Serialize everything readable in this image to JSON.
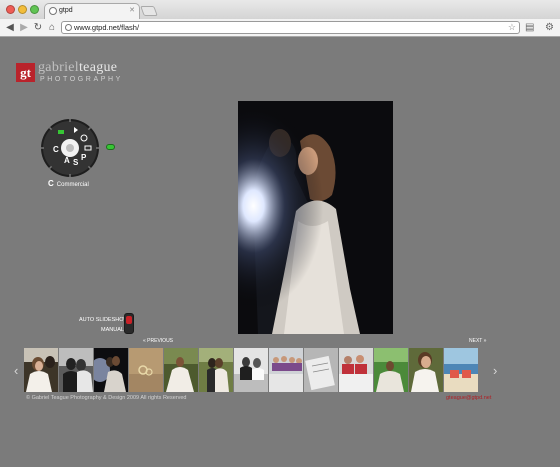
{
  "browser": {
    "tab_title": "gtpd",
    "url": "www.gtpd.net/flash/"
  },
  "logo": {
    "mark": "gt",
    "first_name": "gabriel",
    "last_name": "teague",
    "subtitle": "PHOTOGRAPHY"
  },
  "dial": {
    "letters": [
      "A",
      "S",
      "P",
      "C"
    ],
    "mode_letter": "C",
    "mode_name": "Commercial",
    "led_color": "#37c535"
  },
  "slideshow": {
    "auto_label": "AUTO SLIDESHOW",
    "manual_label": "MANUAL",
    "switch_color": "#c92228"
  },
  "thumbnails": {
    "previous_label": "« PREVIOUS",
    "next_label": "NEXT »",
    "left_arrow": "‹",
    "right_arrow": "›",
    "items": [
      {
        "name": "bride-laughing"
      },
      {
        "name": "couple-bw"
      },
      {
        "name": "couple-dancing-dark"
      },
      {
        "name": "rings-sand"
      },
      {
        "name": "bride-garden"
      },
      {
        "name": "couple-field"
      },
      {
        "name": "groom-bride-bw"
      },
      {
        "name": "bridesmaids"
      },
      {
        "name": "invitation-detail"
      },
      {
        "name": "girls-friends"
      },
      {
        "name": "bride-grass"
      },
      {
        "name": "bride-closeup"
      },
      {
        "name": "beach-chairs"
      }
    ]
  },
  "footer": {
    "copyright": "© Gabriel Teague Photography & Design 2009 All rights Reserved",
    "email": "gteague@gtpd.net"
  },
  "colors": {
    "page_bg": "#7b7b7b",
    "brand_red": "#b9232b"
  }
}
